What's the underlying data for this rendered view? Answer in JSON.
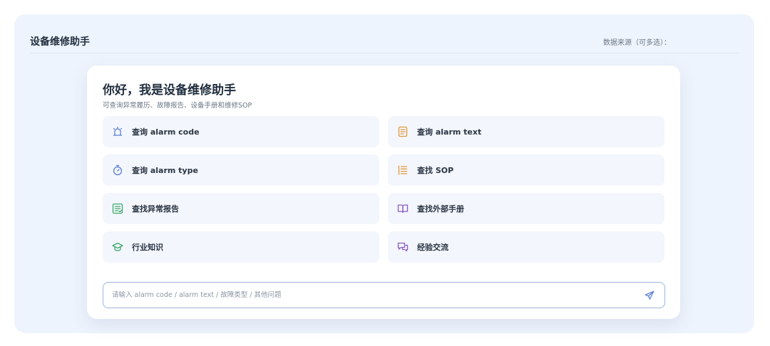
{
  "header": {
    "title": "设备维修助手",
    "data_source_label": "数据来源（可多选）："
  },
  "assistant": {
    "greeting": "你好，我是设备维修助手",
    "subtitle": "可查询异常履历、故障报告、设备手册和维修SOP"
  },
  "actions": [
    {
      "label": "查询 alarm code",
      "icon": "alarm-bell-icon",
      "color": "#5b7fd6"
    },
    {
      "label": "查询 alarm text",
      "icon": "document-text-icon",
      "color": "#e39a3b"
    },
    {
      "label": "查询 alarm type",
      "icon": "stopwatch-icon",
      "color": "#5b7fd6"
    },
    {
      "label": "查找 SOP",
      "icon": "list-icon",
      "color": "#e39a3b"
    },
    {
      "label": "查找异常报告",
      "icon": "report-icon",
      "color": "#3fa86a"
    },
    {
      "label": "查找外部手册",
      "icon": "open-book-icon",
      "color": "#8a5cc7"
    },
    {
      "label": "行业知识",
      "icon": "graduation-cap-icon",
      "color": "#3fa86a"
    },
    {
      "label": "经验交流",
      "icon": "chat-bubbles-icon",
      "color": "#8a5cc7"
    }
  ],
  "input": {
    "placeholder": "请输入 alarm code / alarm text / 故障类型 / 其他问题",
    "value": ""
  },
  "send": {
    "icon": "send-icon",
    "color": "#5b7fd6"
  }
}
